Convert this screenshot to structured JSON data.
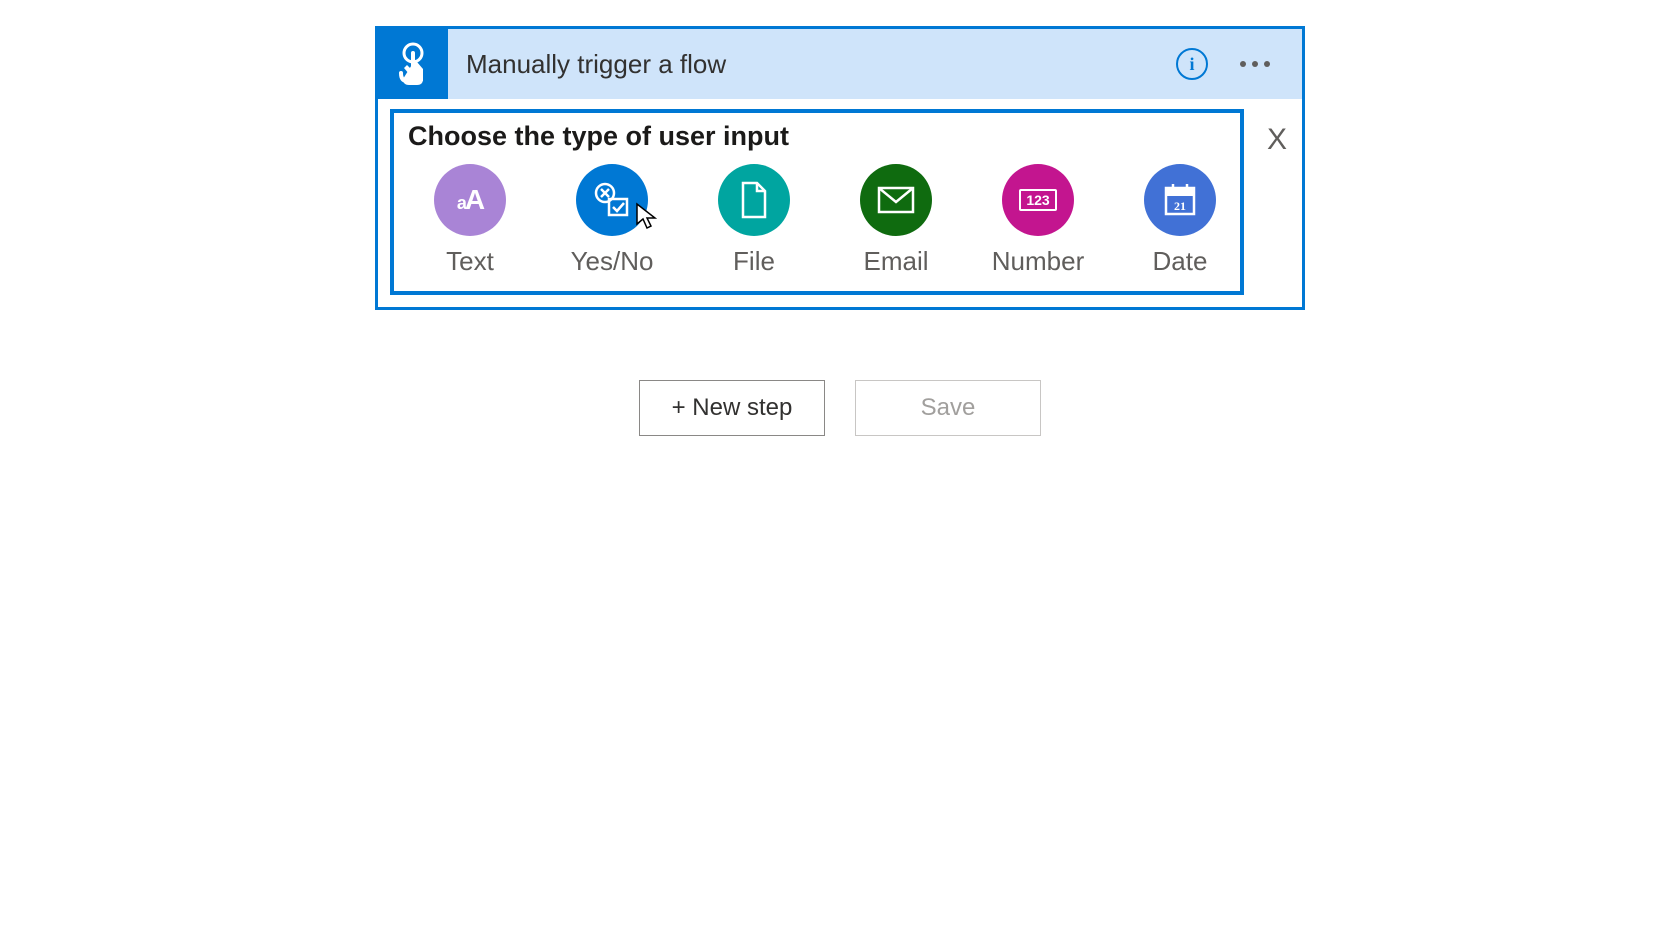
{
  "trigger": {
    "title": "Manually trigger a flow",
    "info_glyph": "i"
  },
  "picker": {
    "heading": "Choose the type of user input",
    "close_label": "X",
    "options": [
      {
        "label": "Text"
      },
      {
        "label": "Yes/No"
      },
      {
        "label": "File"
      },
      {
        "label": "Email"
      },
      {
        "label": "Number"
      },
      {
        "label": "Date"
      }
    ]
  },
  "actions": {
    "new_step": "+ New step",
    "save": "Save"
  },
  "icons": {
    "date_day": "21",
    "number_digits": "123"
  }
}
